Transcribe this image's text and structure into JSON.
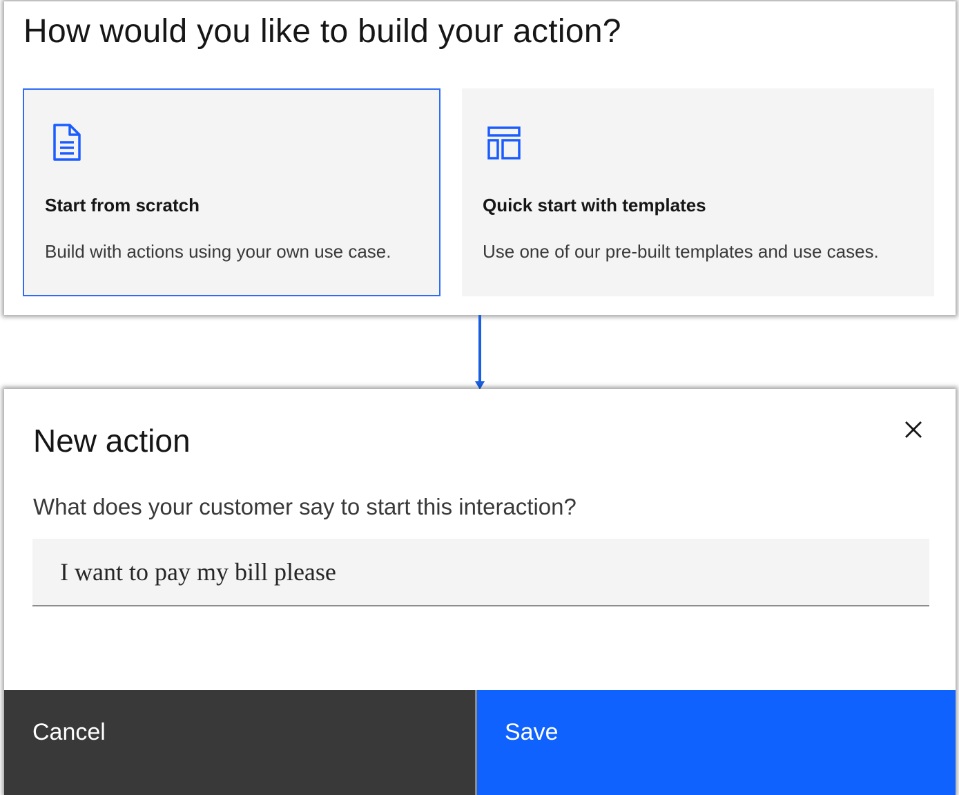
{
  "builder": {
    "title": "How would you like to build your action?",
    "options": [
      {
        "icon": "document-icon",
        "title": "Start from scratch",
        "description": "Build with actions using your own use case.",
        "selected": true
      },
      {
        "icon": "template-icon",
        "title": "Quick start with templates",
        "description": "Use one of our pre-built templates and use cases.",
        "selected": false
      }
    ]
  },
  "connector": {
    "icon": "arrow-down-icon",
    "color": "#1a5fe0"
  },
  "modal": {
    "title": "New action",
    "close_icon": "close-icon",
    "prompt_label": "What does your customer say to start this interaction?",
    "prompt_value": "I want to pay my bill please",
    "cancel_label": "Cancel",
    "save_label": "Save"
  },
  "colors": {
    "accent": "#0f62fe",
    "selected_border": "#2f6cf6",
    "icon_blue": "#1a5cff",
    "tile_bg": "#f4f4f4",
    "cancel_bg": "#393939",
    "text": "#161616"
  }
}
